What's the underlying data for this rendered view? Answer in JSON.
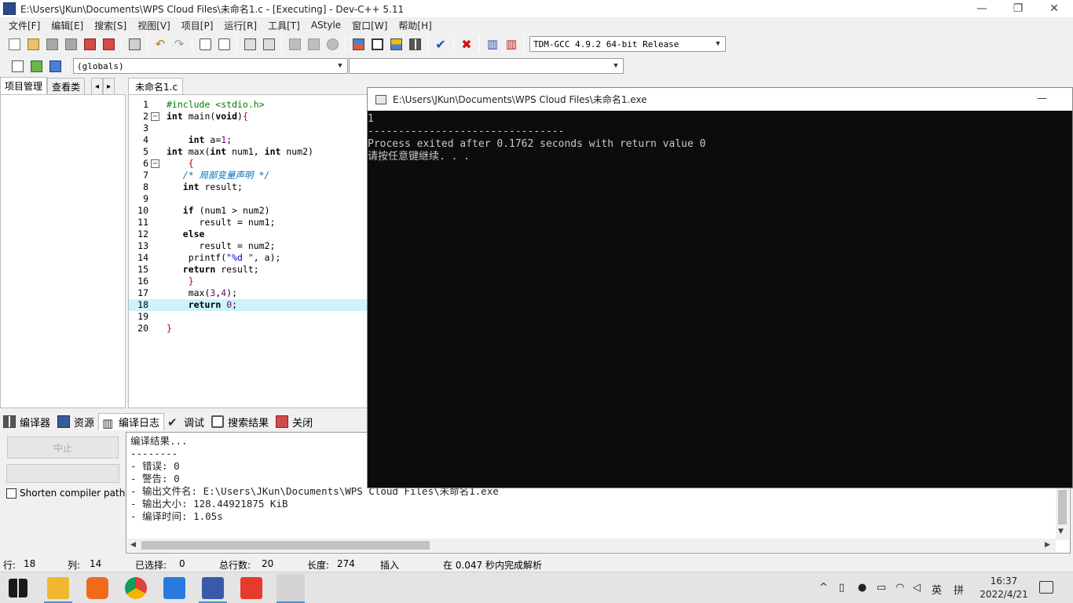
{
  "title_bar": {
    "title": "E:\\Users\\JKun\\Documents\\WPS Cloud Files\\未命名1.c - [Executing] - Dev-C++ 5.11",
    "minimize": "—",
    "restore": "❐",
    "close": "✕"
  },
  "menu": [
    "文件[F]",
    "编辑[E]",
    "搜索[S]",
    "视图[V]",
    "项目[P]",
    "运行[R]",
    "工具[T]",
    "AStyle",
    "窗口[W]",
    "帮助[H]"
  ],
  "toolbar": {
    "compiler_select": "TDM-GCC 4.9.2 64-bit Release",
    "globals_select": "(globals)",
    "function_select": ""
  },
  "left_panel": {
    "tabs": [
      "项目管理",
      "查看类"
    ],
    "nav_prev": "◂",
    "nav_next": "▸"
  },
  "editor": {
    "tab": "未命名1.c",
    "current_line": 18
  },
  "console": {
    "title": "E:\\Users\\JKun\\Documents\\WPS Cloud Files\\未命名1.exe",
    "minimize": "—",
    "lines": [
      "1",
      "--------------------------------",
      "Process exited after 0.1762 seconds with return value 0",
      "请按任意键继续. . ."
    ]
  },
  "bottom_tabs": [
    "编译器",
    "资源",
    "编译日志",
    "调试",
    "搜索结果",
    "关闭"
  ],
  "bottom_left": {
    "stop_button": "中止",
    "shorten_label": "Shorten compiler paths"
  },
  "log": {
    "lines": [
      "编译结果...",
      "--------",
      "- 错误: 0",
      "- 警告: 0",
      "- 输出文件名: E:\\Users\\JKun\\Documents\\WPS Cloud Files\\未命名1.exe",
      "- 输出大小: 128.44921875 KiB",
      "- 编译时间: 1.05s"
    ]
  },
  "status": {
    "row_label": "行:",
    "row": "18",
    "col_label": "列:",
    "col": "14",
    "selected_label": "已选择:",
    "selected": "0",
    "total_label": "总行数:",
    "total": "20",
    "length_label": "长度:",
    "length": "274",
    "mode": "插入",
    "parse": "在 0.047 秒内完成解析"
  },
  "taskbar": {
    "time": "16:37",
    "date": "2022/4/21",
    "ime_lang": "英",
    "ime_mode": "拼"
  },
  "colors": {
    "highlight_line": "#cdf3fb",
    "console_bg": "#0c0c0c",
    "comment": "#0070c0",
    "preprocessor": "#008000"
  }
}
